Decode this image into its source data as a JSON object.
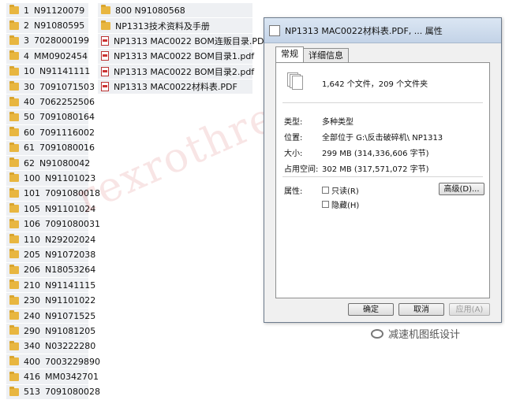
{
  "left_column": [
    {
      "num": "1",
      "code": "N91120079"
    },
    {
      "num": "2",
      "code": "N91080595"
    },
    {
      "num": "3",
      "code": "7028000199"
    },
    {
      "num": "4",
      "code": "MM0902454"
    },
    {
      "num": "10",
      "code": "N91141111"
    },
    {
      "num": "30",
      "code": "7091071503"
    },
    {
      "num": "40",
      "code": "7062252506"
    },
    {
      "num": "50",
      "code": "7091080164"
    },
    {
      "num": "60",
      "code": "7091116002"
    },
    {
      "num": "61",
      "code": "7091080016"
    },
    {
      "num": "62",
      "code": "N91080042"
    },
    {
      "num": "100",
      "code": "N91101023"
    },
    {
      "num": "101",
      "code": "7091080018"
    },
    {
      "num": "105",
      "code": "N91101024"
    },
    {
      "num": "106",
      "code": "7091080031"
    },
    {
      "num": "110",
      "code": "N29202024"
    },
    {
      "num": "205",
      "code": "N91072038"
    },
    {
      "num": "206",
      "code": "N18053264"
    },
    {
      "num": "210",
      "code": "N91141115"
    },
    {
      "num": "230",
      "code": "N91101022"
    },
    {
      "num": "240",
      "code": "N91071525"
    },
    {
      "num": "290",
      "code": "N91081205"
    },
    {
      "num": "340",
      "code": "N03222280"
    },
    {
      "num": "400",
      "code": "7003229890"
    },
    {
      "num": "416",
      "code": "MM0342701"
    },
    {
      "num": "513",
      "code": "7091080028"
    }
  ],
  "right_column": [
    {
      "type": "folder",
      "label": "800  N91080568"
    },
    {
      "type": "folder",
      "label": "NP1313技术资料及手册"
    },
    {
      "type": "pdf",
      "label": "NP1313 MAC0022 BOM连贩目录.PDF"
    },
    {
      "type": "pdf",
      "label": "NP1313 MAC0022 BOM目录1.pdf"
    },
    {
      "type": "pdf",
      "label": "NP1313 MAC0022 BOM目录2.pdf"
    },
    {
      "type": "pdf",
      "label": "NP1313 MAC0022材料表.PDF"
    }
  ],
  "dialog": {
    "title": "NP1313 MAC0022材料表.PDF, ... 属性",
    "tabs": [
      "常规",
      "详细信息"
    ],
    "count_text": "1,642 个文件，209 个文件夹",
    "type_label": "类型:",
    "type_value": "多种类型",
    "location_label": "位置:",
    "location_value": "全部位于 G:\\反击破碎机\\ NP1313",
    "size_label": "大小:",
    "size_value": "299 MB (314,336,606 字节)",
    "disk_label": "占用空间:",
    "disk_value": "302 MB (317,571,072 字节)",
    "attr_label": "属性:",
    "readonly_label": "只读(R)",
    "hidden_label": "隐藏(H)",
    "advanced_button": "高级(D)...",
    "ok_button": "确定",
    "cancel_button": "取消",
    "apply_button": "应用(A)"
  },
  "watermark_text": "rexrothreducer",
  "brand_text": "减速机图纸设计",
  "colors": {
    "folder": "#e8b640",
    "watermark": "#c82828",
    "title_bar": "#c3d3e7"
  }
}
